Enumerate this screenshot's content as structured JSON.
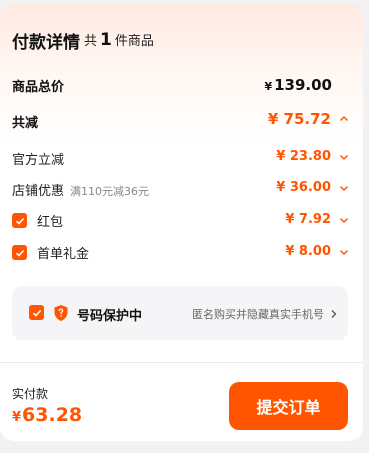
{
  "header": {
    "title": "付款详情",
    "count_prefix": "共",
    "count_value": "1",
    "count_suffix": "件商品"
  },
  "summary": {
    "total_label": "商品总价",
    "total_currency": "¥",
    "total_value": "139.00",
    "discount_label": "共减",
    "discount_value": "¥ 75.72"
  },
  "discounts": [
    {
      "label": "官方立减",
      "note": "",
      "value": "¥ 23.80",
      "checkbox": false
    },
    {
      "label": "店铺优惠",
      "note": "满110元减36元",
      "value": "¥ 36.00",
      "checkbox": false
    },
    {
      "label": "红包",
      "note": "",
      "value": "¥ 7.92",
      "checkbox": true
    },
    {
      "label": "首单礼金",
      "note": "",
      "value": "¥ 8.00",
      "checkbox": true
    }
  ],
  "privacy": {
    "title": "号码保护中",
    "description": "匿名购买并隐藏真实手机号",
    "checked": true
  },
  "footer": {
    "pay_label": "实付款",
    "currency": "¥",
    "amount": "63.28",
    "submit_label": "提交订单"
  },
  "colors": {
    "accent": "#ff5500",
    "text": "#111111",
    "muted": "#888888"
  }
}
